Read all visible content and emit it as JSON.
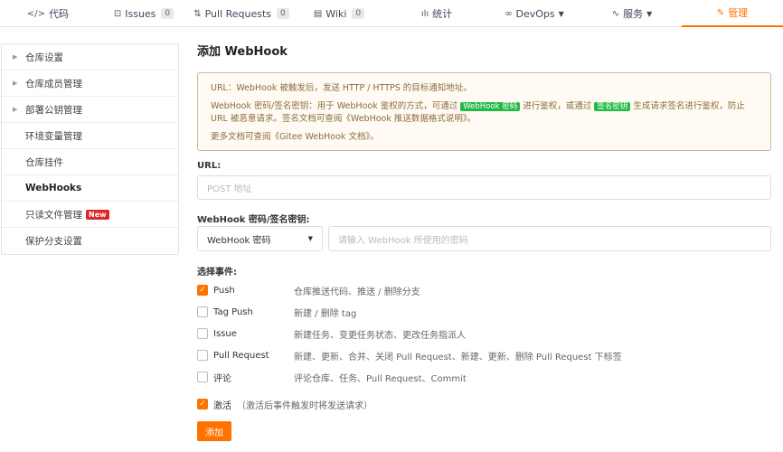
{
  "tabs": [
    {
      "icon": "</>",
      "label": "代码",
      "count": ""
    },
    {
      "icon": "⊡",
      "label": "Issues",
      "count": "0"
    },
    {
      "icon": "⇅",
      "label": "Pull Requests",
      "count": "0"
    },
    {
      "icon": "▤",
      "label": "Wiki",
      "count": "0"
    },
    {
      "icon": "ılı",
      "label": "统计",
      "count": ""
    },
    {
      "icon": "∞",
      "label": "DevOps",
      "count": ""
    },
    {
      "icon": "∿",
      "label": "服务",
      "count": ""
    },
    {
      "icon": "✎",
      "label": "管理",
      "count": ""
    }
  ],
  "sidebar": {
    "items": [
      {
        "label": "仓库设置"
      },
      {
        "label": "仓库成员管理"
      },
      {
        "label": "部署公钥管理"
      },
      {
        "label": "环境变量管理"
      },
      {
        "label": "仓库挂件"
      },
      {
        "label": "WebHooks"
      },
      {
        "label": "只读文件管理",
        "badge": "New"
      },
      {
        "label": "保护分支设置"
      }
    ]
  },
  "main": {
    "title": "添加 WebHook",
    "notice": {
      "line1": "URL：WebHook 被触发后，发送 HTTP / HTTPS 的目标通知地址。",
      "line2_a": "WebHook 密码/签名密钥：用于 WebHook 鉴权的方式，可通过",
      "tag1": "WebHook 密码",
      "line2_b": "进行鉴权，或通过",
      "tag2": "签名密钥",
      "line2_c": "生成请求签名进行鉴权，防止 URL 被恶意请求。签名文档可查阅",
      "doc_link": "《WebHook 推送数据格式说明》",
      "line2_end": "。",
      "line3_a": "更多文档可查阅",
      "gitee_link": "《Gitee WebHook 文档》",
      "line3_end": "。"
    },
    "url_label": "URL:",
    "url_placeholder": "POST 地址",
    "secret_label": "WebHook 密码/签名密钥:",
    "secret_type": "WebHook 密码",
    "secret_placeholder": "请输入 WebHook 所使用的密码",
    "events_label": "选择事件:",
    "events": [
      {
        "name": "Push",
        "desc": "仓库推送代码、推送 / 删除分支",
        "checked": true
      },
      {
        "name": "Tag Push",
        "desc": "新建 / 删除 tag",
        "checked": false
      },
      {
        "name": "Issue",
        "desc": "新建任务、变更任务状态、更改任务指派人",
        "checked": false
      },
      {
        "name": "Pull Request",
        "desc": "新建、更新、合并、关闭 Pull Request、新建、更新、删除 Pull Request 下标签",
        "checked": false
      },
      {
        "name": "评论",
        "desc": "评论仓库、任务、Pull Request、Commit",
        "checked": false
      }
    ],
    "active_label": "激活",
    "active_hint": "（激活后事件触发时将发送请求）",
    "active_checked": true,
    "submit_label": "添加"
  },
  "colors": {
    "accent": "#fe7300",
    "notice_bg": "#fffaf3",
    "notice_text": "#8a6d3b",
    "tag_green": "#21ba45",
    "badge_red": "#db2828"
  }
}
